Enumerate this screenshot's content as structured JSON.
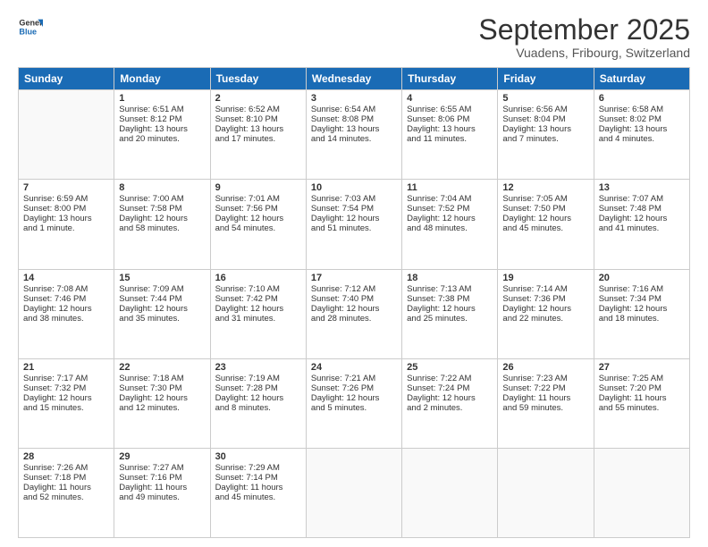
{
  "logo": {
    "general": "General",
    "blue": "Blue"
  },
  "header": {
    "month": "September 2025",
    "location": "Vuadens, Fribourg, Switzerland"
  },
  "days": [
    "Sunday",
    "Monday",
    "Tuesday",
    "Wednesday",
    "Thursday",
    "Friday",
    "Saturday"
  ],
  "weeks": [
    [
      {
        "day": "",
        "content": ""
      },
      {
        "day": "1",
        "content": "Sunrise: 6:51 AM\nSunset: 8:12 PM\nDaylight: 13 hours\nand 20 minutes."
      },
      {
        "day": "2",
        "content": "Sunrise: 6:52 AM\nSunset: 8:10 PM\nDaylight: 13 hours\nand 17 minutes."
      },
      {
        "day": "3",
        "content": "Sunrise: 6:54 AM\nSunset: 8:08 PM\nDaylight: 13 hours\nand 14 minutes."
      },
      {
        "day": "4",
        "content": "Sunrise: 6:55 AM\nSunset: 8:06 PM\nDaylight: 13 hours\nand 11 minutes."
      },
      {
        "day": "5",
        "content": "Sunrise: 6:56 AM\nSunset: 8:04 PM\nDaylight: 13 hours\nand 7 minutes."
      },
      {
        "day": "6",
        "content": "Sunrise: 6:58 AM\nSunset: 8:02 PM\nDaylight: 13 hours\nand 4 minutes."
      }
    ],
    [
      {
        "day": "7",
        "content": "Sunrise: 6:59 AM\nSunset: 8:00 PM\nDaylight: 13 hours\nand 1 minute."
      },
      {
        "day": "8",
        "content": "Sunrise: 7:00 AM\nSunset: 7:58 PM\nDaylight: 12 hours\nand 58 minutes."
      },
      {
        "day": "9",
        "content": "Sunrise: 7:01 AM\nSunset: 7:56 PM\nDaylight: 12 hours\nand 54 minutes."
      },
      {
        "day": "10",
        "content": "Sunrise: 7:03 AM\nSunset: 7:54 PM\nDaylight: 12 hours\nand 51 minutes."
      },
      {
        "day": "11",
        "content": "Sunrise: 7:04 AM\nSunset: 7:52 PM\nDaylight: 12 hours\nand 48 minutes."
      },
      {
        "day": "12",
        "content": "Sunrise: 7:05 AM\nSunset: 7:50 PM\nDaylight: 12 hours\nand 45 minutes."
      },
      {
        "day": "13",
        "content": "Sunrise: 7:07 AM\nSunset: 7:48 PM\nDaylight: 12 hours\nand 41 minutes."
      }
    ],
    [
      {
        "day": "14",
        "content": "Sunrise: 7:08 AM\nSunset: 7:46 PM\nDaylight: 12 hours\nand 38 minutes."
      },
      {
        "day": "15",
        "content": "Sunrise: 7:09 AM\nSunset: 7:44 PM\nDaylight: 12 hours\nand 35 minutes."
      },
      {
        "day": "16",
        "content": "Sunrise: 7:10 AM\nSunset: 7:42 PM\nDaylight: 12 hours\nand 31 minutes."
      },
      {
        "day": "17",
        "content": "Sunrise: 7:12 AM\nSunset: 7:40 PM\nDaylight: 12 hours\nand 28 minutes."
      },
      {
        "day": "18",
        "content": "Sunrise: 7:13 AM\nSunset: 7:38 PM\nDaylight: 12 hours\nand 25 minutes."
      },
      {
        "day": "19",
        "content": "Sunrise: 7:14 AM\nSunset: 7:36 PM\nDaylight: 12 hours\nand 22 minutes."
      },
      {
        "day": "20",
        "content": "Sunrise: 7:16 AM\nSunset: 7:34 PM\nDaylight: 12 hours\nand 18 minutes."
      }
    ],
    [
      {
        "day": "21",
        "content": "Sunrise: 7:17 AM\nSunset: 7:32 PM\nDaylight: 12 hours\nand 15 minutes."
      },
      {
        "day": "22",
        "content": "Sunrise: 7:18 AM\nSunset: 7:30 PM\nDaylight: 12 hours\nand 12 minutes."
      },
      {
        "day": "23",
        "content": "Sunrise: 7:19 AM\nSunset: 7:28 PM\nDaylight: 12 hours\nand 8 minutes."
      },
      {
        "day": "24",
        "content": "Sunrise: 7:21 AM\nSunset: 7:26 PM\nDaylight: 12 hours\nand 5 minutes."
      },
      {
        "day": "25",
        "content": "Sunrise: 7:22 AM\nSunset: 7:24 PM\nDaylight: 12 hours\nand 2 minutes."
      },
      {
        "day": "26",
        "content": "Sunrise: 7:23 AM\nSunset: 7:22 PM\nDaylight: 11 hours\nand 59 minutes."
      },
      {
        "day": "27",
        "content": "Sunrise: 7:25 AM\nSunset: 7:20 PM\nDaylight: 11 hours\nand 55 minutes."
      }
    ],
    [
      {
        "day": "28",
        "content": "Sunrise: 7:26 AM\nSunset: 7:18 PM\nDaylight: 11 hours\nand 52 minutes."
      },
      {
        "day": "29",
        "content": "Sunrise: 7:27 AM\nSunset: 7:16 PM\nDaylight: 11 hours\nand 49 minutes."
      },
      {
        "day": "30",
        "content": "Sunrise: 7:29 AM\nSunset: 7:14 PM\nDaylight: 11 hours\nand 45 minutes."
      },
      {
        "day": "",
        "content": ""
      },
      {
        "day": "",
        "content": ""
      },
      {
        "day": "",
        "content": ""
      },
      {
        "day": "",
        "content": ""
      }
    ]
  ]
}
